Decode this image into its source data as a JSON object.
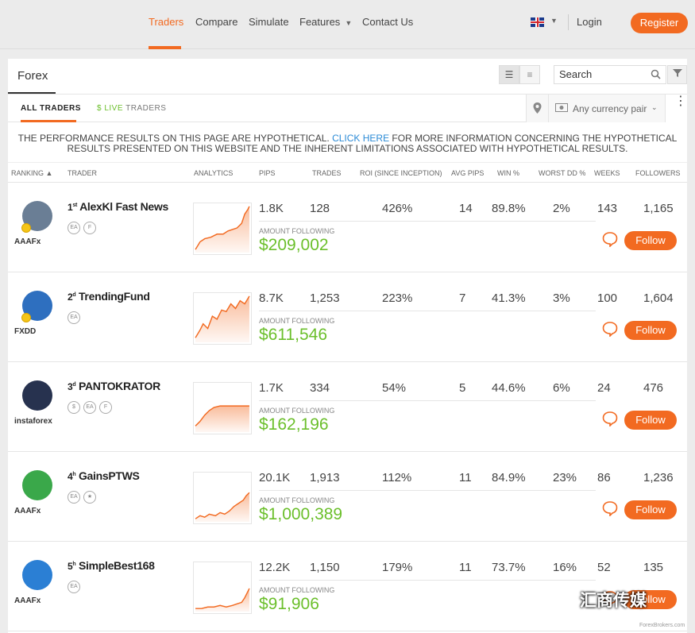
{
  "nav": {
    "links": [
      "Traders",
      "Compare",
      "Simulate",
      "Features",
      "Contact Us"
    ],
    "login": "Login",
    "register": "Register",
    "language_flag": "uk-flag-icon"
  },
  "panel": {
    "title": "Forex",
    "search_placeholder": "Search",
    "tabs": {
      "all": "ALL TRADERS",
      "live_prefix": "$ LIVE",
      "live_suffix": "TRADERS"
    },
    "currency_filter": "Any currency pair",
    "disclaimer_before": "THE PERFORMANCE RESULTS ON THIS PAGE ARE HYPOTHETICAL. ",
    "disclaimer_link": "CLICK HERE",
    "disclaimer_after": " FOR MORE INFORMATION CONCERNING THE HYPOTHETICAL RESULTS PRESENTED ON THIS WEBSITE AND THE INHERENT LIMITATIONS ASSOCIATED WITH HYPOTHETICAL RESULTS."
  },
  "columns": [
    "RANKING",
    "TRADER",
    "ANALYTICS",
    "PIPS",
    "TRADES",
    "ROI (SINCE INCEPTION)",
    "AVG PIPS",
    "WIN %",
    "WORST DD %",
    "WEEKS",
    "FOLLOWERS"
  ],
  "amount_label": "AMOUNT FOLLOWING",
  "follow_label": "Follow",
  "traders": [
    {
      "rank": "1",
      "rank_suffix": "st",
      "name": "AlexKl Fast News",
      "badges": [
        "EA",
        "F"
      ],
      "broker": "AAAFx",
      "pips": "1.8K",
      "trades": "128",
      "roi": "426%",
      "avg_pips": "14",
      "win": "89.8%",
      "dd": "2%",
      "weeks": "143",
      "followers": "1,165",
      "amount": "$209,002",
      "avatar_color": "#6a7e95",
      "medal": true
    },
    {
      "rank": "2",
      "rank_suffix": "d",
      "name": "TrendingFund",
      "badges": [
        "EA"
      ],
      "broker": "FXDD",
      "pips": "8.7K",
      "trades": "1,253",
      "roi": "223%",
      "avg_pips": "7",
      "win": "41.3%",
      "dd": "3%",
      "weeks": "100",
      "followers": "1,604",
      "amount": "$611,546",
      "avatar_color": "#2e6fbf",
      "medal": true
    },
    {
      "rank": "3",
      "rank_suffix": "d",
      "name": "PANTOKRATOR",
      "badges": [
        "$",
        "EA",
        "F"
      ],
      "broker": "instaforex",
      "pips": "1.7K",
      "trades": "334",
      "roi": "54%",
      "avg_pips": "5",
      "win": "44.6%",
      "dd": "6%",
      "weeks": "24",
      "followers": "476",
      "amount": "$162,196",
      "avatar_color": "#27324f",
      "medal": false
    },
    {
      "rank": "4",
      "rank_suffix": "h",
      "name": "GainsPTWS",
      "badges": [
        "EA",
        "★"
      ],
      "broker": "AAAFx",
      "pips": "20.1K",
      "trades": "1,913",
      "roi": "112%",
      "avg_pips": "11",
      "win": "84.9%",
      "dd": "23%",
      "weeks": "86",
      "followers": "1,236",
      "amount": "$1,000,389",
      "avatar_color": "#3aa84a",
      "medal": false
    },
    {
      "rank": "5",
      "rank_suffix": "h",
      "name": "SimpleBest168",
      "badges": [
        "EA"
      ],
      "broker": "AAAFx",
      "pips": "12.2K",
      "trades": "1,150",
      "roi": "179%",
      "avg_pips": "11",
      "win": "73.7%",
      "dd": "16%",
      "weeks": "52",
      "followers": "135",
      "amount": "$91,906",
      "avatar_color": "#2b7fd4",
      "medal": false
    }
  ],
  "watermark": "汇商传媒",
  "watermark_small": "ForexBrokers.com",
  "colors": {
    "accent": "#f26a21",
    "money": "#6bbf2b",
    "link": "#2a8ad6"
  }
}
